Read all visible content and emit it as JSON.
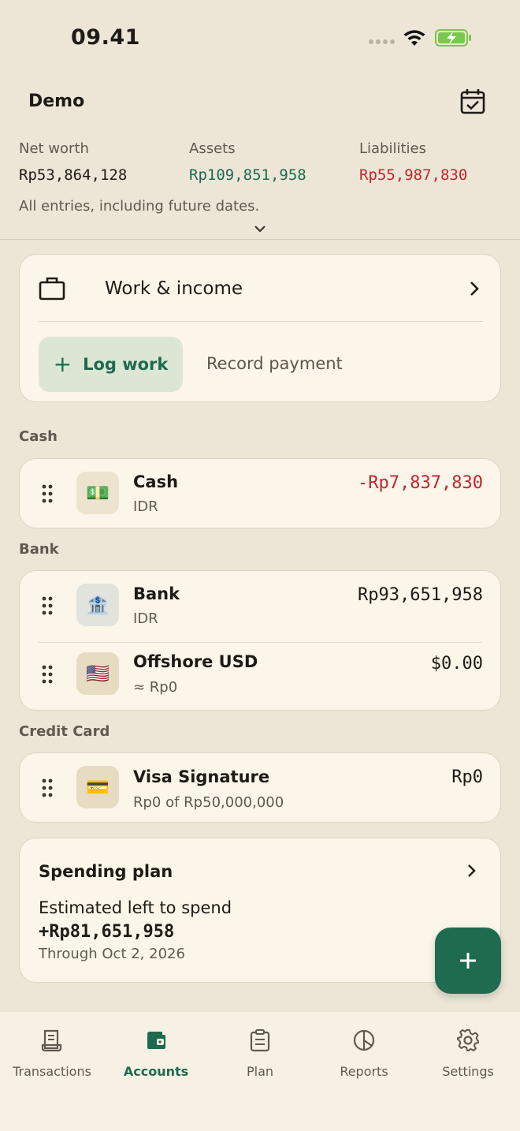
{
  "status_bar": {
    "time": "09.41"
  },
  "header": {
    "title": "Demo"
  },
  "summary": {
    "net_worth_label": "Net worth",
    "net_worth_value": "Rp53,864,128",
    "assets_label": "Assets",
    "assets_value": "Rp109,851,958",
    "liabilities_label": "Liabilities",
    "liabilities_value": "Rp55,987,830",
    "note": "All entries, including future dates."
  },
  "work": {
    "title": "Work & income",
    "log_label": "Log work",
    "record_label": "Record payment"
  },
  "sections": [
    {
      "label": "Cash",
      "accounts": [
        {
          "name": "Cash",
          "sub": "IDR",
          "amount": "-Rp7,837,830",
          "emoji": "💵",
          "negative": true
        }
      ]
    },
    {
      "label": "Bank",
      "accounts": [
        {
          "name": "Bank",
          "sub": "IDR",
          "amount": "Rp93,651,958",
          "emoji": "🏦"
        },
        {
          "name": "Offshore USD",
          "sub": "≈ Rp0",
          "amount": "$0.00",
          "emoji": "🇺🇸"
        }
      ]
    },
    {
      "label": "Credit Card",
      "accounts": [
        {
          "name": "Visa Signature",
          "sub": "Rp0 of Rp50,000,000",
          "amount": "Rp0",
          "emoji": "💳"
        }
      ]
    }
  ],
  "plan": {
    "title": "Spending plan",
    "label": "Estimated left to spend",
    "amount": "+Rp81,651,958",
    "through": "Through Oct 2, 2026"
  },
  "nav": {
    "items": [
      {
        "label": "Transactions",
        "icon": "receipt-icon"
      },
      {
        "label": "Accounts",
        "icon": "wallet-icon",
        "active": true
      },
      {
        "label": "Plan",
        "icon": "clipboard-icon"
      },
      {
        "label": "Reports",
        "icon": "pie-chart-icon"
      },
      {
        "label": "Settings",
        "icon": "gear-icon"
      }
    ]
  },
  "colors": {
    "accent": "#1e6b50",
    "positive": "#1d6a4f",
    "negative": "#c2262e",
    "background": "#ede6d7",
    "card": "#fbf5ea"
  }
}
